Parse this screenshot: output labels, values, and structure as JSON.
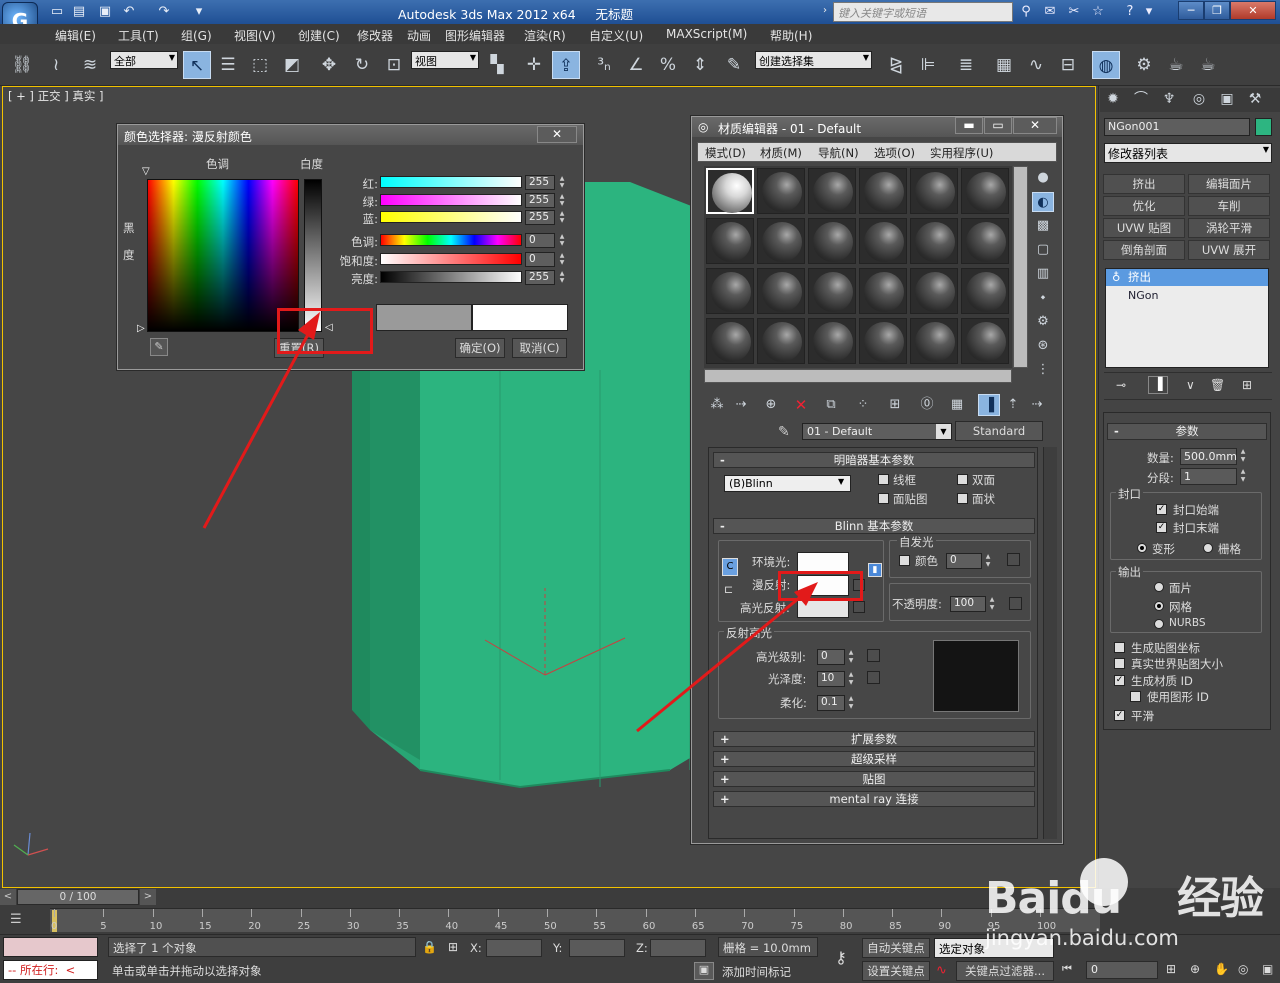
{
  "titlebar": {
    "title": "Autodesk 3ds Max  2012 x64",
    "file_name": "无标题",
    "search_placeholder": "键入关键字或短语",
    "minimize": "─",
    "restore": "❐",
    "close": "✕"
  },
  "menu": [
    "编辑(E)",
    "工具(T)",
    "组(G)",
    "视图(V)",
    "创建(C)",
    "修改器",
    "动画",
    "图形编辑器",
    "渲染(R)",
    "自定义(U)",
    "MAXScript(M)",
    "帮助(H)"
  ],
  "toolbar": {
    "selection_filter": "全部",
    "ref_coord": "视图",
    "named_selection": "创建选择集"
  },
  "viewport": {
    "label": "[ + ] 正交 ] 真实 ]",
    "object_color": "#2db581"
  },
  "color_picker": {
    "title": "颜色选择器: 漫反射颜色",
    "hue_label": "色调",
    "whiteness_label": "白度",
    "black_label": "黑",
    "degree_label": "度",
    "rows": [
      {
        "label": "红:",
        "value": "255"
      },
      {
        "label": "绿:",
        "value": "255"
      },
      {
        "label": "蓝:",
        "value": "255"
      },
      {
        "label": "色调:",
        "value": "0"
      },
      {
        "label": "饱和度:",
        "value": "0"
      },
      {
        "label": "亮度:",
        "value": "255"
      }
    ],
    "reset": "重置(R)",
    "ok": "确定(O)",
    "cancel": "取消(C)",
    "close": "✕"
  },
  "material_editor": {
    "title": "材质编辑器 - 01 - Default",
    "menu": [
      "模式(D)",
      "材质(M)",
      "导航(N)",
      "选项(O)",
      "实用程序(U)"
    ],
    "material_name": "01 - Default",
    "material_type": "Standard",
    "shader_rollout": "明暗器基本参数",
    "shader_type": "(B)Blinn",
    "shader_opts": [
      "线框",
      "双面",
      "面贴图",
      "面状"
    ],
    "blinn_rollout": "Blinn 基本参数",
    "self_illum": "自发光",
    "color_label": "颜色",
    "color_value": "0",
    "ambient": "环境光:",
    "diffuse": "漫反射:",
    "specular": "高光反射:",
    "opacity_label": "不透明度:",
    "opacity_value": "100",
    "spec_highlights": "反射高光",
    "spec_level": "高光级别:",
    "spec_level_value": "0",
    "glossiness": "光泽度:",
    "glossiness_value": "10",
    "soften": "柔化:",
    "soften_value": "0.1",
    "rollouts": [
      "扩展参数",
      "超级采样",
      "贴图",
      "mental ray 连接"
    ],
    "close": "✕"
  },
  "command_panel": {
    "object_name": "NGon001",
    "modifier_list": "修改器列表",
    "buttons": [
      "挤出",
      "编辑面片",
      "优化",
      "车削",
      "UVW 贴图",
      "涡轮平滑",
      "倒角剖面",
      "UVW 展开"
    ],
    "stack": [
      "挤出",
      "NGon"
    ],
    "params_title": "参数",
    "amount_label": "数量:",
    "amount_value": "500.0mm",
    "segments_label": "分段:",
    "segments_value": "1",
    "capping": "封口",
    "cap_start": "封口始端",
    "cap_end": "封口末端",
    "morph": "变形",
    "grid": "栅格",
    "output": "输出",
    "patch": "面片",
    "mesh": "网格",
    "nurbs": "NURBS",
    "gen_map": "生成贴图坐标",
    "real_world": "真实世界贴图大小",
    "gen_mat_id": "生成材质 ID",
    "use_shape_id": "使用图形 ID",
    "smooth": "平滑"
  },
  "timeline": {
    "frame": "0 / 100",
    "ticks": [
      "0",
      "5",
      "10",
      "15",
      "20",
      "25",
      "30",
      "35",
      "40",
      "45",
      "50",
      "55",
      "60",
      "65",
      "70",
      "75",
      "80",
      "85",
      "90",
      "95",
      "100"
    ]
  },
  "status": {
    "selected": "选择了 1 个对象",
    "prompt": "单击或单击并拖动以选择对象",
    "current": "所在行:",
    "x_label": "X:",
    "y_label": "Y:",
    "z_label": "Z:",
    "grid": "栅格 = 10.0mm",
    "auto_key": "自动关键点",
    "set_key": "设置关键点",
    "selected_obj": "选定对象",
    "key_filters": "关键点过滤器...",
    "add_time_tag": "添加时间标记",
    "frame_field": "0"
  },
  "watermark": {
    "brand": "Baidu",
    "brand_cn": "经验",
    "url": "jingyan.baidu.com"
  }
}
